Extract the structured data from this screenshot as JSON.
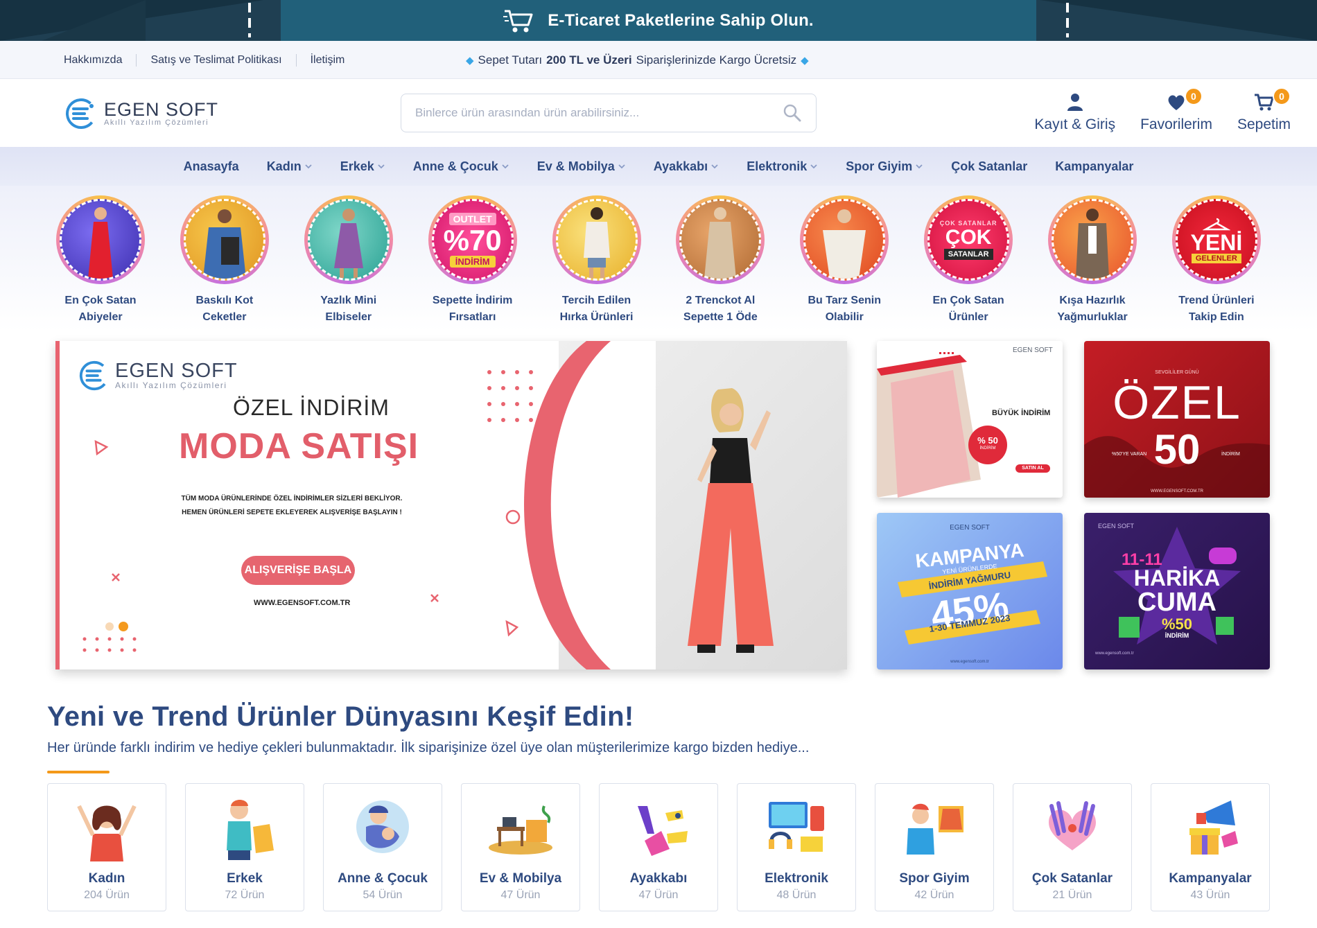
{
  "promo": {
    "text": "E-Ticaret Paketlerine Sahip Olun."
  },
  "infobar": {
    "links": [
      "Hakkımızda",
      "Satış ve Teslimat Politikası",
      "İletişim"
    ],
    "ship_pre": "Sepet Tutarı",
    "ship_bold": "200 TL ve Üzeri",
    "ship_post": "Siparişlerinizde Kargo Ücretsiz"
  },
  "header": {
    "logo_name": "EGEN SOFT",
    "logo_tag": "Akıllı Yazılım Çözümleri",
    "search_placeholder": "Binlerce ürün arasından ürün arabilirsiniz...",
    "account_label": "Kayıt & Giriş",
    "favorites_label": "Favorilerim",
    "favorites_count": "0",
    "cart_label": "Sepetim",
    "cart_count": "0"
  },
  "nav": [
    {
      "label": "Anasayfa",
      "dropdown": false
    },
    {
      "label": "Kadın",
      "dropdown": true
    },
    {
      "label": "Erkek",
      "dropdown": true
    },
    {
      "label": "Anne & Çocuk",
      "dropdown": true
    },
    {
      "label": "Ev & Mobilya",
      "dropdown": true
    },
    {
      "label": "Ayakkabı",
      "dropdown": true
    },
    {
      "label": "Elektronik",
      "dropdown": true
    },
    {
      "label": "Spor Giyim",
      "dropdown": true
    },
    {
      "label": "Çok Satanlar",
      "dropdown": false
    },
    {
      "label": "Kampanyalar",
      "dropdown": false
    }
  ],
  "stories": [
    {
      "line1": "En Çok Satan",
      "line2": "Abiyeler"
    },
    {
      "line1": "Baskılı Kot",
      "line2": "Ceketler"
    },
    {
      "line1": "Yazlık Mini",
      "line2": "Elbiseler"
    },
    {
      "line1": "Sepette İndirim",
      "line2": "Fırsatları",
      "art1": "OUTLET",
      "art2": "%70",
      "art3": "İNDİRİM"
    },
    {
      "line1": "Tercih Edilen",
      "line2": "Hırka Ürünleri"
    },
    {
      "line1": "2 Trenckot Al",
      "line2": "Sepette 1 Öde"
    },
    {
      "line1": "Bu Tarz Senin",
      "line2": "Olabilir"
    },
    {
      "line1": "En Çok Satan",
      "line2": "Ürünler",
      "art1": "ÇOK SATANLAR",
      "art2": "ÇOK",
      "art3": "SATANLAR"
    },
    {
      "line1": "Kışa Hazırlık",
      "line2": "Yağmurluklar"
    },
    {
      "line1": "Trend Ürünleri",
      "line2": "Takip Edin",
      "art1": "YENİ",
      "art2": "GELENLER"
    }
  ],
  "banner": {
    "logo_name": "EGEN SOFT",
    "logo_tag": "Akıllı Yazılım Çözümleri",
    "subtitle": "ÖZEL İNDİRİM",
    "title": "MODA SATIŞI",
    "desc1": "TÜM MODA ÜRÜNLERİNDE ÖZEL İNDİRİMLER SİZLERİ BEKLİYOR.",
    "desc2": "HEMEN ÜRÜNLERİ SEPETE EKLEYEREK ALIŞVERİŞE BAŞLAYIN !",
    "button": "ALIŞVERİŞE BAŞLA",
    "url": "WWW.EGENSOFT.COM.TR"
  },
  "tiles": {
    "t1": {
      "brand": "EGEN SOFT",
      "label": "BÜYÜK İNDİRİM",
      "pct": "% 50",
      "pct_sub": "İNDİRİM",
      "btn": "SATIN AL"
    },
    "t2": {
      "top": "SEVGİLİLER GÜNÜ",
      "big": "ÖZEL",
      "num": "50",
      "left": "%50'YE VARAN",
      "right": "İNDİRİM",
      "url": "WWW.EGENSOFT.COM.TR"
    },
    "t3": {
      "brand": "EGEN SOFT",
      "title": "KAMPANYA",
      "sub": "YENİ ÜRÜNLERDE",
      "ribbon": "İNDİRİM YAĞMURU",
      "pct": "45%",
      "date": "1-30 TEMMUZ 2023",
      "url": "www.egensoft.com.tr"
    },
    "t4": {
      "brand": "EGEN SOFT",
      "date": "11-11",
      "l1": "HARİKA",
      "l2": "CUMA",
      "pct": "%50",
      "pct_sub": "İNDİRİM",
      "url": "www.egensoft.com.tr"
    }
  },
  "section": {
    "title": "Yeni ve Trend Ürünler Dünyasını Keşif Edin!",
    "desc": "Her üründe farklı indirim ve hediye çekleri bulunmaktadır. İlk siparişinize özel üye olan müşterilerimize kargo bizden hediye..."
  },
  "categories": [
    {
      "name": "Kadın",
      "count": "204 Ürün"
    },
    {
      "name": "Erkek",
      "count": "72 Ürün"
    },
    {
      "name": "Anne & Çocuk",
      "count": "54 Ürün"
    },
    {
      "name": "Ev & Mobilya",
      "count": "47 Ürün"
    },
    {
      "name": "Ayakkabı",
      "count": "47 Ürün"
    },
    {
      "name": "Elektronik",
      "count": "48 Ürün"
    },
    {
      "name": "Spor Giyim",
      "count": "42 Ürün"
    },
    {
      "name": "Çok Satanlar",
      "count": "21 Ürün"
    },
    {
      "name": "Kampanyalar",
      "count": "43 Ürün"
    }
  ],
  "colors": {
    "accent": "#2e4a80",
    "orange": "#f4991a",
    "promo_bar": "#21607a",
    "banner_red": "#e25e6a"
  }
}
